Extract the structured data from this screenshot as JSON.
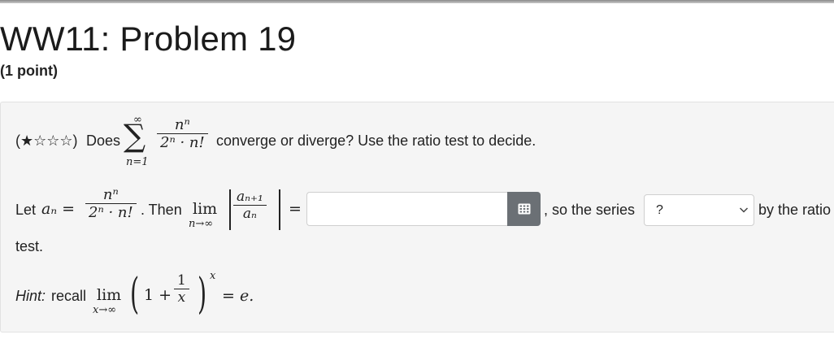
{
  "header": {
    "title": "WW11: Problem 19",
    "points": "(1 point)"
  },
  "problem": {
    "difficulty": "(★☆☆☆)",
    "does": "Does",
    "question_rest": "converge or diverge? Use the ratio test to decide.",
    "sum_upper": "∞",
    "sum_lower": "n=1",
    "series_num": "nⁿ",
    "series_den": "2ⁿ · n!",
    "let": "Let",
    "an_lhs": "aₙ =",
    "an_num": "nⁿ",
    "an_den": "2ⁿ · n!",
    "then": ". Then",
    "lim": "lim",
    "lim_sub": "n→∞",
    "ratio_num": "aₙ₊₁",
    "ratio_den": "aₙ",
    "equals": "=",
    "so_the_series": ", so the series",
    "by_the_ratio": "by the ratio",
    "test": "test.",
    "answer_value": "",
    "select_value": "?"
  },
  "hint": {
    "label": "Hint:",
    "recall": "recall",
    "lim": "lim",
    "lim_sub": "x→∞",
    "one_plus": "1 +",
    "frac_num": "1",
    "frac_den": "x",
    "exponent": "x",
    "result": "= e."
  },
  "icons": {
    "keypad": "keypad-icon",
    "chevron": "chevron-down-icon"
  },
  "colors": {
    "panel_bg": "#f5f5f5",
    "keypad_button": "#6b7075"
  }
}
